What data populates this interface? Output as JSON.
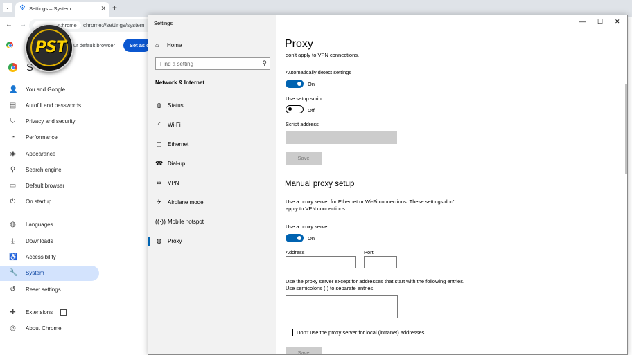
{
  "browser": {
    "tab_title": "Settings – System",
    "url": "chrome://settings/system",
    "chip_label": "Chrome",
    "infobar_message": "ur default browser",
    "infobar_button": "Set as d",
    "page_heading": "S",
    "nav": [
      {
        "label": "You and Google",
        "icon": "person-icon"
      },
      {
        "label": "Autofill and passwords",
        "icon": "clipboard-icon"
      },
      {
        "label": "Privacy and security",
        "icon": "shield-icon"
      },
      {
        "label": "Performance",
        "icon": "gauge-icon"
      },
      {
        "label": "Appearance",
        "icon": "palette-icon"
      },
      {
        "label": "Search engine",
        "icon": "search-icon"
      },
      {
        "label": "Default browser",
        "icon": "browser-icon"
      },
      {
        "label": "On startup",
        "icon": "power-icon"
      },
      {
        "label": "Languages",
        "icon": "globe-icon"
      },
      {
        "label": "Downloads",
        "icon": "download-icon"
      },
      {
        "label": "Accessibility",
        "icon": "accessibility-icon"
      },
      {
        "label": "System",
        "icon": "wrench-icon",
        "active": true
      },
      {
        "label": "Reset settings",
        "icon": "history-icon"
      },
      {
        "label": "Extensions",
        "icon": "puzzle-icon"
      },
      {
        "label": "About Chrome",
        "icon": "chrome-icon"
      }
    ],
    "watermark_text": "PST"
  },
  "win": {
    "title": "Settings",
    "home_label": "Home",
    "search_placeholder": "Find a setting",
    "section_label": "Network & Internet",
    "items": [
      {
        "label": "Status",
        "icon": "globe-icon"
      },
      {
        "label": "Wi-Fi",
        "icon": "wifi-icon"
      },
      {
        "label": "Ethernet",
        "icon": "ethernet-icon"
      },
      {
        "label": "Dial-up",
        "icon": "dialup-icon"
      },
      {
        "label": "VPN",
        "icon": "vpn-icon"
      },
      {
        "label": "Airplane mode",
        "icon": "airplane-icon"
      },
      {
        "label": "Mobile hotspot",
        "icon": "hotspot-icon"
      },
      {
        "label": "Proxy",
        "icon": "globe-icon",
        "active": true
      }
    ]
  },
  "proxy": {
    "title": "Proxy",
    "cut_text": "don't apply to VPN connections.",
    "auto_detect_label": "Automatically detect settings",
    "auto_detect_state": "On",
    "setup_script_label": "Use setup script",
    "setup_script_state": "Off",
    "script_address_label": "Script address",
    "script_save": "Save",
    "manual_title": "Manual proxy setup",
    "manual_desc": "Use a proxy server for Ethernet or Wi-Fi connections. These settings don't apply to VPN connections.",
    "use_proxy_label": "Use a proxy server",
    "use_proxy_state": "On",
    "address_label": "Address",
    "port_label": "Port",
    "exceptions_desc": "Use the proxy server except for addresses that start with the following entries. Use semicolons (;) to separate entries.",
    "local_checkbox_label": "Don't use the proxy server for local (intranet) addresses",
    "manual_save": "Save"
  },
  "colors": {
    "toggle_on": "#0063b1",
    "chrome_active_bg": "#d3e3fd"
  }
}
